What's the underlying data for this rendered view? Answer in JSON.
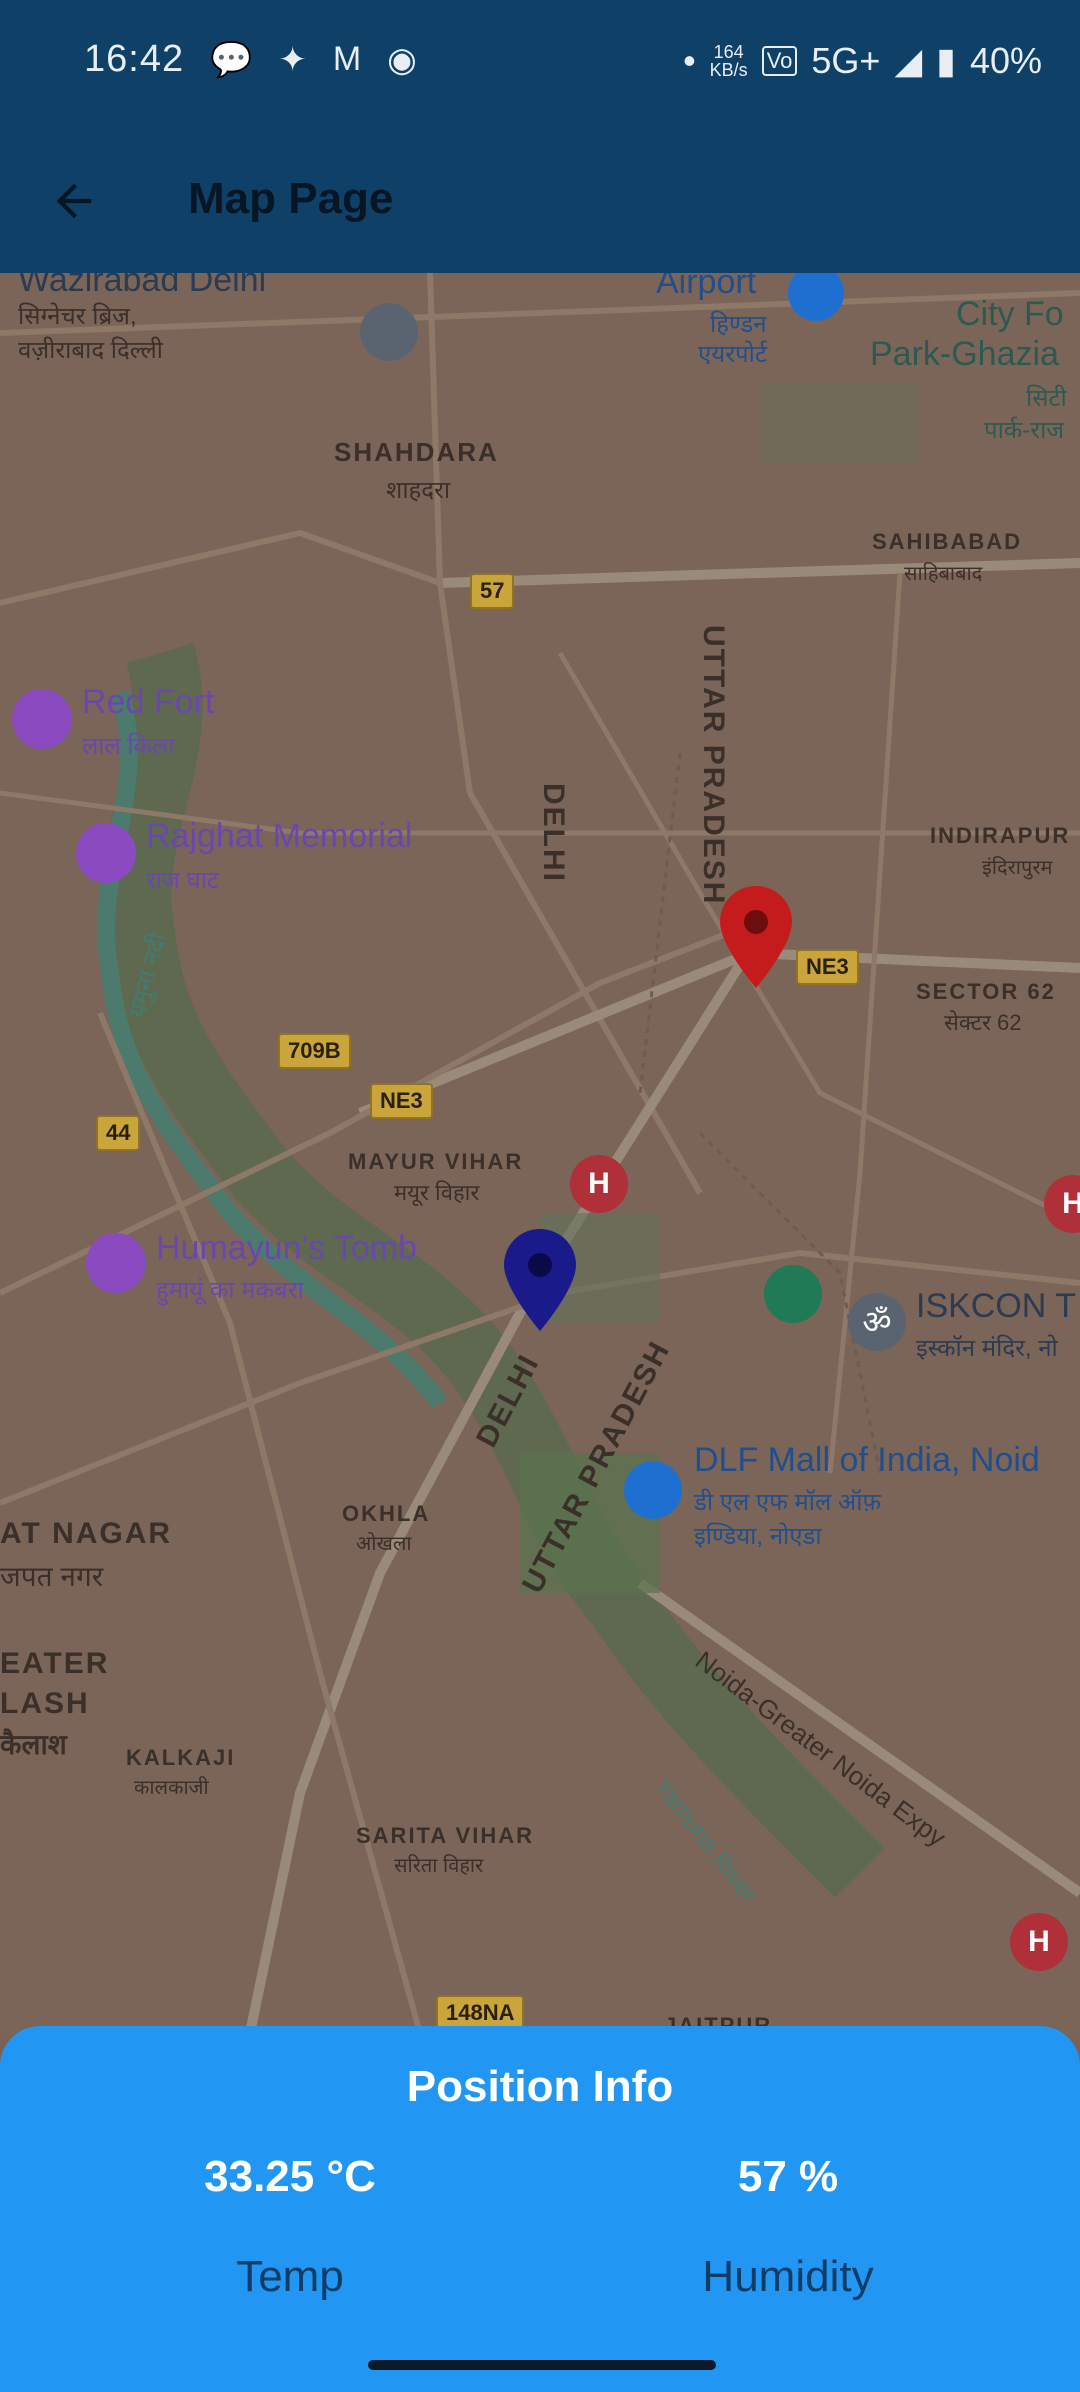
{
  "status_bar": {
    "time": "16:42",
    "speed_value": "164",
    "speed_unit": "KB/s",
    "network": "5G+",
    "battery": "40%"
  },
  "app_bar": {
    "title": "Map Page"
  },
  "map": {
    "places": {
      "wazirabad": "Wazirabad Delhi",
      "wazirabad_hi1": "सिग्नेचर ब्रिज,",
      "wazirabad_hi2": "वज़ीराबाद दिल्ली",
      "airport": "Airport",
      "airport_hi1": "हिण्डन",
      "airport_hi2": "एयरपोर्ट",
      "cityforest": "City Fo",
      "cityforest2": "Park-Ghazia",
      "cityforest_hi1": "सिटी",
      "cityforest_hi2": "पार्क-राज",
      "shahdara": "SHAHDARA",
      "shahdara_hi": "शाहदरा",
      "sahibabad": "SAHIBABAD",
      "sahibabad_hi": "साहिबाबाद",
      "redfort": "Red Fort",
      "redfort_hi": "लाल किला",
      "rajghat": "Rajghat Memorial",
      "rajghat_hi": "राज घाट",
      "delhi1": "DELHI",
      "up1": "UTTAR PRADESH",
      "indirapuram": "INDIRAPUR",
      "indirapuram_hi": "इंदिरापुरम",
      "sector62": "SECTOR 62",
      "sector62_hi": "सेक्टर 62",
      "mayurvihar": "MAYUR VIHAR",
      "mayurvihar_hi": "मयूर विहार",
      "humayun": "Humayun's Tomb",
      "humayun_hi": "हुमायूं का मकबरा",
      "iskcon": "ISKCON T",
      "iskcon_hi": "इस्कॉन मंदिर, नो",
      "delhi2": "DELHI",
      "up2": "UTTAR PRADESH",
      "dlf": "DLF Mall of India, Noid",
      "dlf_hi1": "डी एल एफ मॉल ऑफ़",
      "dlf_hi2": "इण्डिया, नोएडा",
      "okhla": "OKHLA",
      "okhla_hi": "ओखला",
      "latnagar": "AT NAGAR",
      "latnagar_hi": "जपत नगर",
      "eater": "EATER",
      "lash": "LASH",
      "kailash_hi": "कैलाश",
      "kalkaji": "KALKAJI",
      "kalkaji_hi": "कालकाजी",
      "saritavihar": "SARITA VIHAR",
      "saritavihar_hi": "सरिता विहार",
      "noidaexpy": "Noida-Greater Noida Expy",
      "yamuna": "Yamuna River",
      "yamuna_hi": "यमुना नदी",
      "jaitpur": "JAITPUR"
    },
    "shields": {
      "s57": "57",
      "ne3a": "NE3",
      "ne3b": "NE3",
      "s709b": "709B",
      "s44": "44",
      "s148na": "148NA"
    },
    "colors": {
      "red_marker": "#c41c1c",
      "blue_marker": "#1a1a8a"
    }
  },
  "sheet": {
    "title": "Position Info",
    "temp_value": "33.25 °C",
    "temp_label": "Temp",
    "humidity_value": "57 %",
    "humidity_label": "Humidity"
  }
}
